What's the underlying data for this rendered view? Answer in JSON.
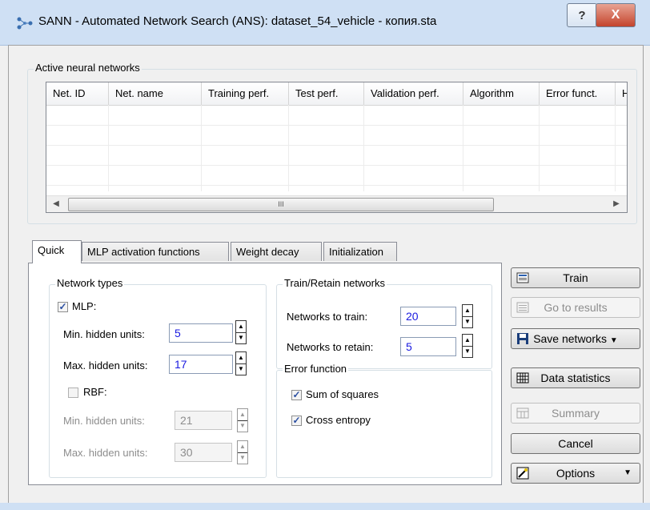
{
  "window": {
    "title": "SANN - Automated Network Search (ANS): dataset_54_vehicle - копия.sta",
    "help_glyph": "?",
    "close_glyph": "X"
  },
  "networks_group": {
    "label": "Active neural networks",
    "columns": [
      "Net. ID",
      "Net. name",
      "Training perf.",
      "Test perf.",
      "Validation perf.",
      "Algorithm",
      "Error funct.",
      "H"
    ],
    "rows": [],
    "scroll_left": "◀",
    "scroll_right": "▶",
    "scroll_grip": "III"
  },
  "tabs": [
    {
      "label": "Quick",
      "active": true
    },
    {
      "label": "MLP activation functions",
      "active": false
    },
    {
      "label": "Weight decay",
      "active": false
    },
    {
      "label": "Initialization",
      "active": false
    }
  ],
  "network_types": {
    "label": "Network types",
    "mlp": {
      "label": "MLP:",
      "checked": true,
      "min_label": "Min. hidden units:",
      "min_value": "5",
      "max_label": "Max. hidden units:",
      "max_value": "17"
    },
    "rbf": {
      "label": "RBF:",
      "checked": false,
      "min_label": "Min. hidden units:",
      "min_value": "21",
      "max_label": "Max. hidden units:",
      "max_value": "30"
    }
  },
  "train_retain": {
    "label": "Train/Retain networks",
    "train_label": "Networks to train:",
    "train_value": "20",
    "retain_label": "Networks to retain:",
    "retain_value": "5"
  },
  "error_function": {
    "label": "Error function",
    "sum_label": "Sum of squares",
    "sum_checked": true,
    "cross_label": "Cross entropy",
    "cross_checked": true
  },
  "buttons": {
    "train": "Train",
    "go_to_results": "Go to results",
    "save_networks": "Save networks",
    "data_statistics": "Data statistics",
    "summary": "Summary",
    "cancel": "Cancel",
    "options": "Options"
  },
  "glyphs": {
    "check": "✓",
    "up": "▲",
    "down": "▼"
  },
  "colors": {
    "value_text": "#1a1ae0",
    "title_bar": "#cfe0f4",
    "close_button": "#c4442c"
  }
}
